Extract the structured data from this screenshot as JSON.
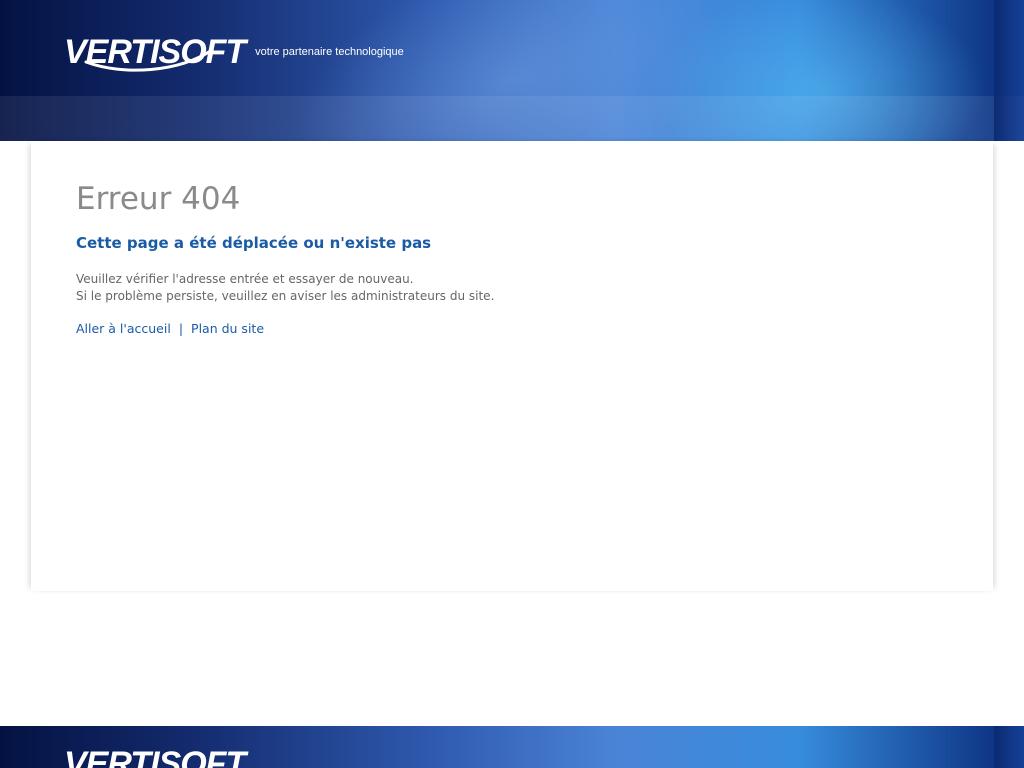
{
  "header": {
    "logo_text": "VERTISOFT",
    "tagline": "votre partenaire technologique"
  },
  "main": {
    "title": "Erreur 404",
    "subtitle": "Cette page a été déplacée ou n'existe pas",
    "message_line1": "Veuillez vérifier l'adresse entrée et essayer de nouveau.",
    "message_line2": "Si le problème persiste, veuillez en aviser les administrateurs du site.",
    "links": {
      "home": "Aller à l'accueil",
      "separator": "|",
      "sitemap": "Plan du site"
    }
  },
  "footer": {
    "logo_text": "VERTISOFT"
  },
  "colors": {
    "link_blue": "#1a5ba6",
    "title_gray": "#8a8a8a",
    "header_navy": "#061e64"
  }
}
